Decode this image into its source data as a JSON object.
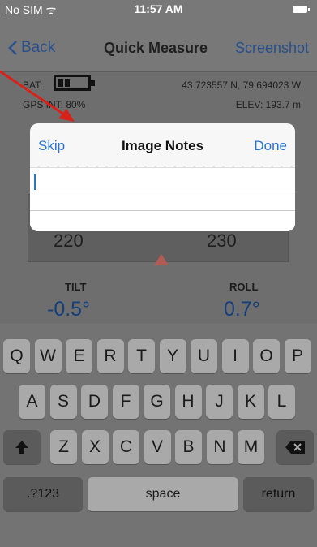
{
  "status_bar": {
    "carrier": "No SIM ᯤ",
    "time": "11:57 AM"
  },
  "nav": {
    "back_label": "Back",
    "title": "Quick Measure",
    "right_label": "Screenshot"
  },
  "info": {
    "bat_label": "BAT:",
    "coords": "43.723557 N,  79.694023 W",
    "gps_label": "GPS INT: 80%",
    "elev_label": "ELEV: 193.7 m"
  },
  "gauges": {
    "left_number": "220",
    "right_number": "230",
    "tilt_label": "TILT",
    "tilt_value": "-0.5°",
    "roll_label": "ROLL",
    "roll_value": "0.7°"
  },
  "dialog": {
    "skip": "Skip",
    "title": "Image Notes",
    "done": "Done",
    "notes_value": ""
  },
  "keyboard": {
    "row1": [
      "Q",
      "W",
      "E",
      "R",
      "T",
      "Y",
      "U",
      "I",
      "O",
      "P"
    ],
    "row2": [
      "A",
      "S",
      "D",
      "F",
      "G",
      "H",
      "J",
      "K",
      "L"
    ],
    "row3": [
      "Z",
      "X",
      "C",
      "V",
      "B",
      "N",
      "M"
    ],
    "numbers_key": ".?123",
    "space_key": "space",
    "return_key": "return"
  },
  "colors": {
    "accent": "#2a73cf",
    "value_blue": "#153f7a",
    "arrow_red": "#d6221a"
  }
}
